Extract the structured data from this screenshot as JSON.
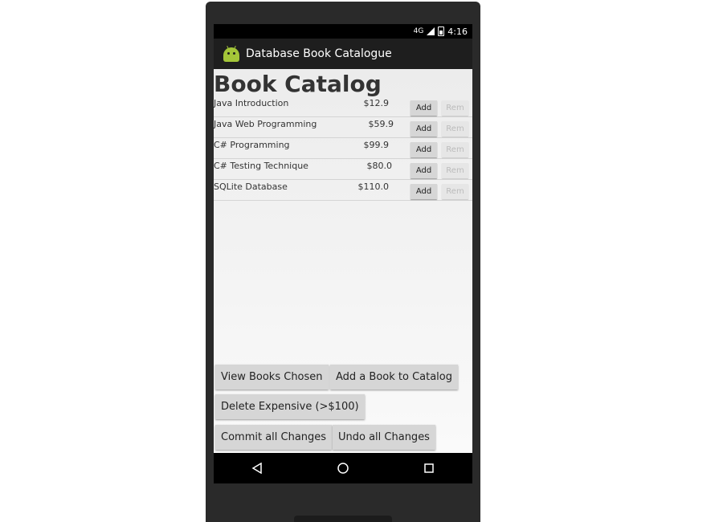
{
  "status_bar": {
    "time": "4:16",
    "network": "4G"
  },
  "app_bar": {
    "title": "Database Book Catalogue",
    "icon": "android-icon"
  },
  "page": {
    "title": "Book Catalog"
  },
  "books": [
    {
      "name": "Java Introduction",
      "price": "$12.9",
      "add_label": "Add",
      "rem_label": "Rem"
    },
    {
      "name": "Java Web Programming",
      "price": "$59.9",
      "add_label": "Add",
      "rem_label": "Rem"
    },
    {
      "name": "C# Programming",
      "price": "$99.9",
      "add_label": "Add",
      "rem_label": "Rem"
    },
    {
      "name": "C# Testing Technique",
      "price": "$80.0",
      "add_label": "Add",
      "rem_label": "Rem"
    },
    {
      "name": "SQLite Database",
      "price": "$110.0",
      "add_label": "Add",
      "rem_label": "Rem"
    }
  ],
  "actions": {
    "view_chosen": "View Books Chosen",
    "add_book": "Add a Book to Catalog",
    "delete_expensive": "Delete Expensive (>$100)",
    "commit": "Commit all Changes",
    "undo": "Undo all Changes"
  },
  "nav": {
    "back_icon": "back-icon",
    "home_icon": "home-icon",
    "recents_icon": "recents-icon"
  },
  "colors": {
    "android_green": "#a4c639",
    "action_bar": "#1e1e1e",
    "button": "#d6d6d6"
  }
}
